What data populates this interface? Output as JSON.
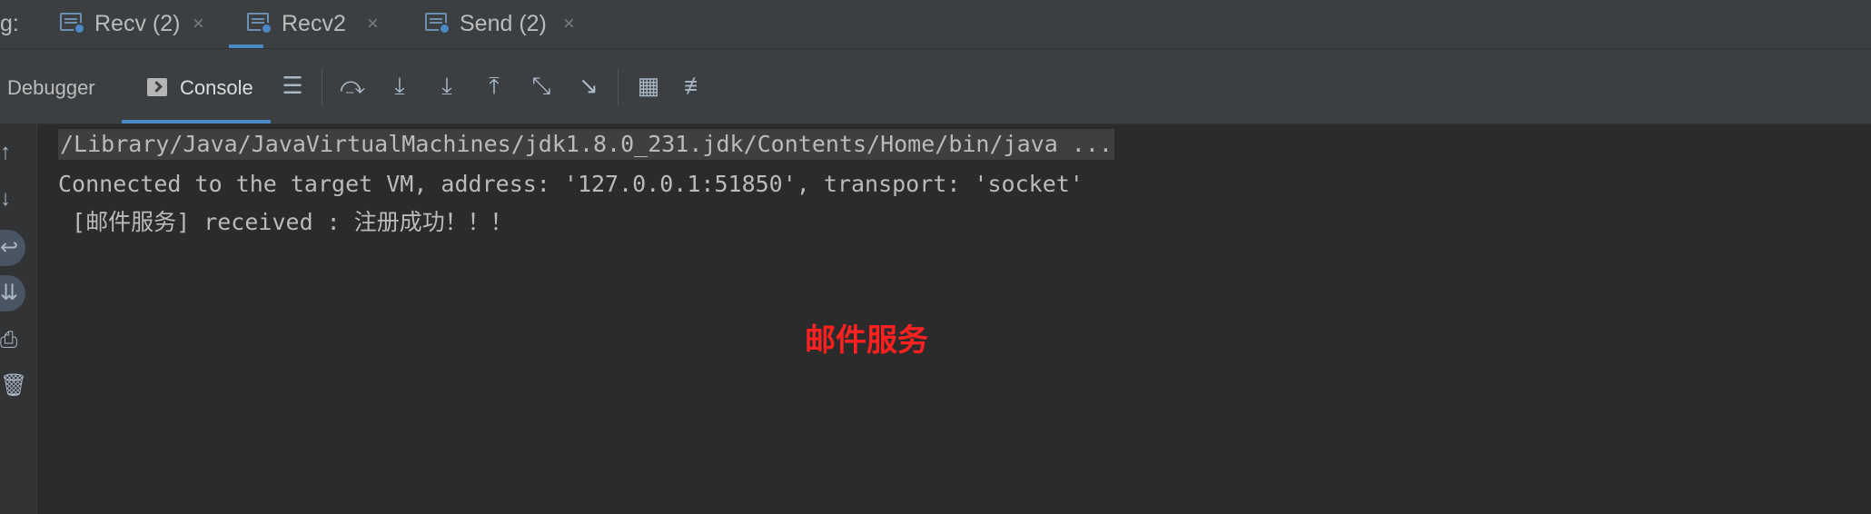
{
  "tabbar": {
    "prefix": "g:",
    "tabs": [
      {
        "label": "Recv (2)",
        "close": "×",
        "active": false
      },
      {
        "label": "Recv2",
        "close": "×",
        "active": true
      },
      {
        "label": "Send (2)",
        "close": "×",
        "active": false
      }
    ]
  },
  "toolbar": {
    "debugger_label": "Debugger",
    "console_label": "Console"
  },
  "console": {
    "command_line": "/Library/Java/JavaVirtualMachines/jdk1.8.0_231.jdk/Contents/Home/bin/java ...",
    "connected_line": "Connected to the target VM, address: '127.0.0.1:51850', transport: 'socket'",
    "received_line": " [邮件服务] received : 注册成功！！！"
  },
  "annotation": "邮件服务",
  "colors": {
    "accent": "#4a88c7",
    "annotation": "#ff2020",
    "background": "#2b2b2b"
  }
}
